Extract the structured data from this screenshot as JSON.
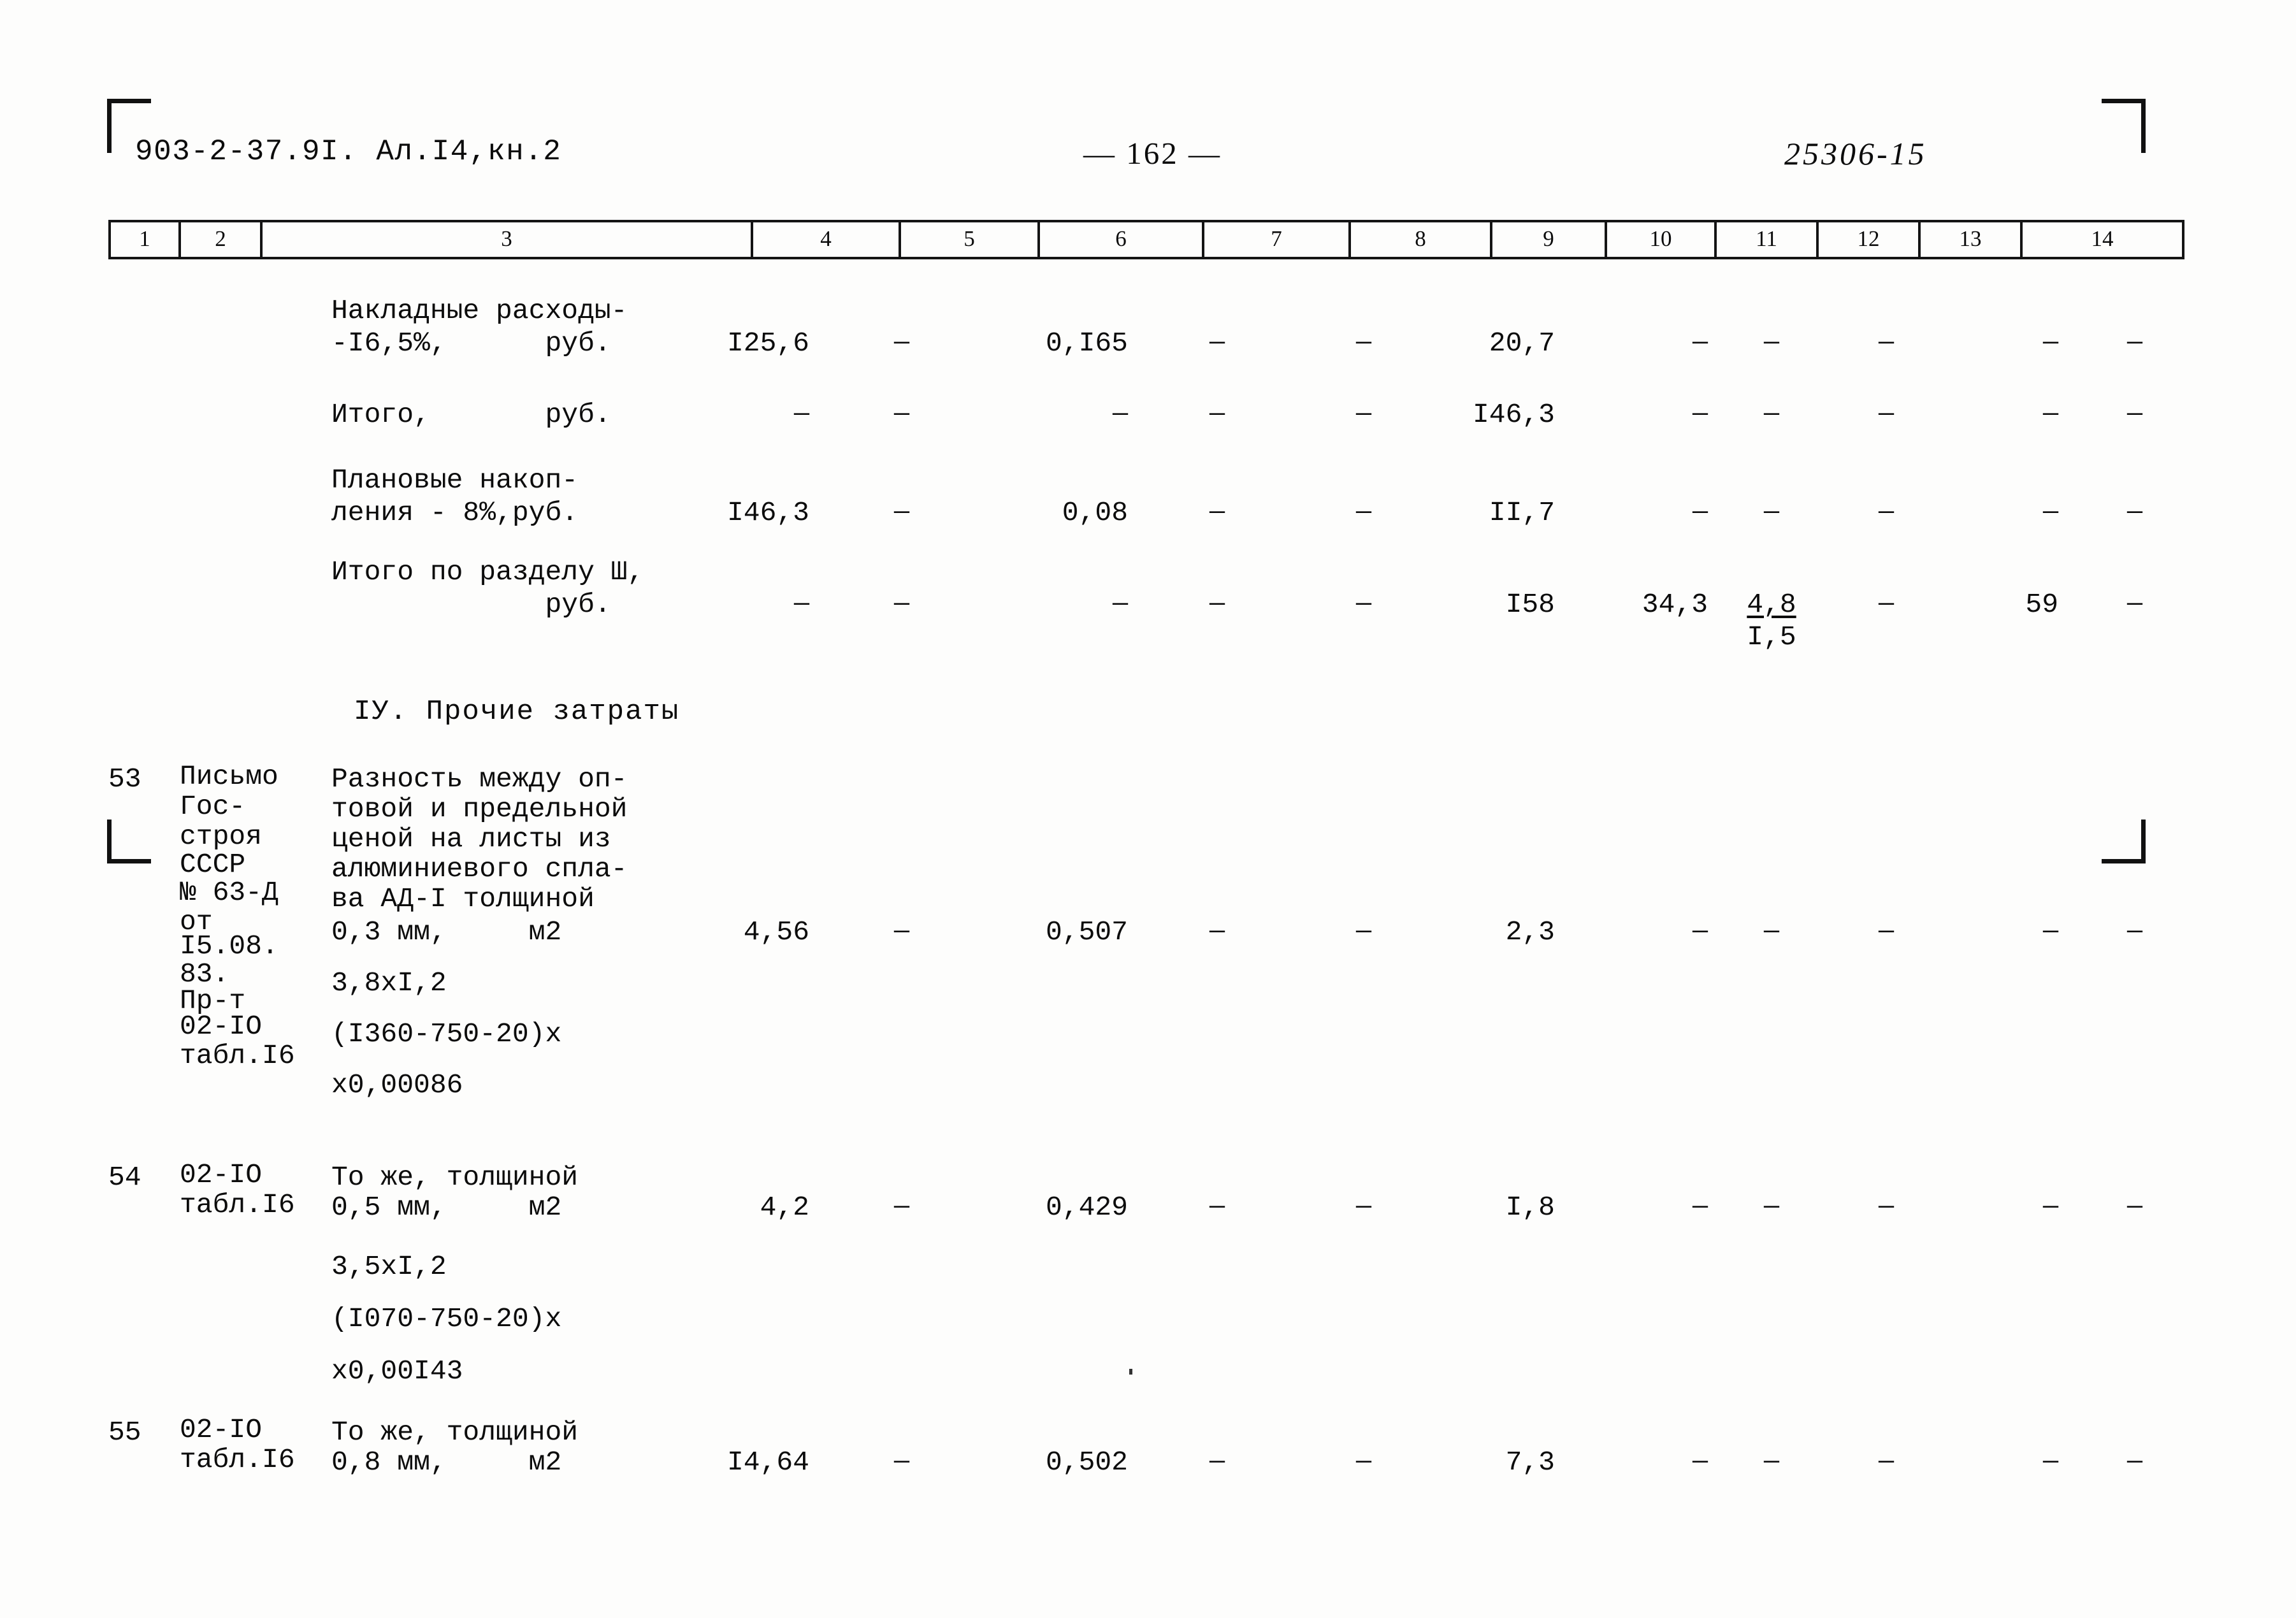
{
  "header": {
    "document_code": "903-2-37.9I. Ал.I4,кн.2",
    "page_number": "— 162 —",
    "archive_code": "25306-15"
  },
  "table": {
    "column_numbers": [
      "1",
      "2",
      "3",
      "4",
      "5",
      "6",
      "7",
      "8",
      "9",
      "10",
      "11",
      "12",
      "13",
      "14"
    ],
    "section_heading": "IУ. Прочие затраты",
    "dash": "—",
    "rows": [
      {
        "id": "overhead",
        "num": "",
        "code": "",
        "desc_lines": [
          "Накладные расходы-",
          "-I6,5%,      руб."
        ],
        "c4": "I25,6",
        "c5": "—",
        "c6": "0,I65",
        "c7": "—",
        "c8": "—",
        "c9": "20,7",
        "c10": "—",
        "c11": "—",
        "c12": "—",
        "c13": "—",
        "c14": "—"
      },
      {
        "id": "subtotal",
        "num": "",
        "code": "",
        "desc_lines": [
          "Итого,       руб."
        ],
        "c4": "—",
        "c5": "—",
        "c6": "—",
        "c7": "—",
        "c8": "—",
        "c9": "I46,3",
        "c10": "—",
        "c11": "—",
        "c12": "—",
        "c13": "—",
        "c14": "—"
      },
      {
        "id": "planned-savings",
        "num": "",
        "code": "",
        "desc_lines": [
          "Плановые накоп-",
          "ления - 8%,руб."
        ],
        "c4": "I46,3",
        "c5": "—",
        "c6": "0,08",
        "c7": "—",
        "c8": "—",
        "c9": "II,7",
        "c10": "—",
        "c11": "—",
        "c12": "—",
        "c13": "—",
        "c14": "—"
      },
      {
        "id": "section-3-total",
        "num": "",
        "code": "",
        "desc_lines": [
          "Итого по разделу Ш,",
          "             руб."
        ],
        "c4": "—",
        "c5": "—",
        "c6": "—",
        "c7": "—",
        "c8": "—",
        "c9": "I58",
        "c10": "34,3",
        "c11": "4,8",
        "c11_second": "I,5",
        "c12": "—",
        "c13": "59",
        "c14": "—"
      },
      {
        "id": "item-53",
        "num": "53",
        "code_lines": [
          "Письмо",
          "Гос-",
          "строя",
          "СССР",
          "№ 63-Д",
          "от",
          "I5.08.",
          "83.",
          "Пр-т",
          "02-IO",
          "табл.I6"
        ],
        "desc_lines": [
          "Разность между оп-",
          "товой и предельной",
          "ценой на листы из",
          "алюминиевого спла-",
          "ва АД-I толщиной",
          "0,3 мм,     м2",
          "",
          "3,8xI,2",
          "",
          "(I360-750-20)x",
          "",
          "x0,00086"
        ],
        "c4": "4,56",
        "c5": "—",
        "c6": "0,507",
        "c7": "—",
        "c8": "—",
        "c9": "2,3",
        "c10": "—",
        "c11": "—",
        "c12": "—",
        "c13": "—",
        "c14": "—"
      },
      {
        "id": "item-54",
        "num": "54",
        "code_lines": [
          "02-IO",
          "табл.I6"
        ],
        "desc_lines": [
          "То же, толщиной",
          "0,5 мм,     м2",
          "",
          "3,5xI,2",
          "",
          "(I070-750-20)x",
          "",
          "x0,00I43"
        ],
        "c4": "4,2",
        "c5": "—",
        "c6": "0,429",
        "c7": "—",
        "c8": "—",
        "c9": "I,8",
        "c10": "—",
        "c11": "—",
        "c12": "—",
        "c13": "—",
        "c14": "—"
      },
      {
        "id": "item-55",
        "num": "55",
        "code_lines": [
          "02-IO",
          "табл.I6"
        ],
        "desc_lines": [
          "То же, толщиной",
          "0,8 мм,     м2"
        ],
        "c4": "I4,64",
        "c5": "—",
        "c6": "0,502",
        "c7": "—",
        "c8": "—",
        "c9": "7,3",
        "c10": "—",
        "c11": "—",
        "c12": "—",
        "c13": "—",
        "c14": "—"
      }
    ]
  }
}
